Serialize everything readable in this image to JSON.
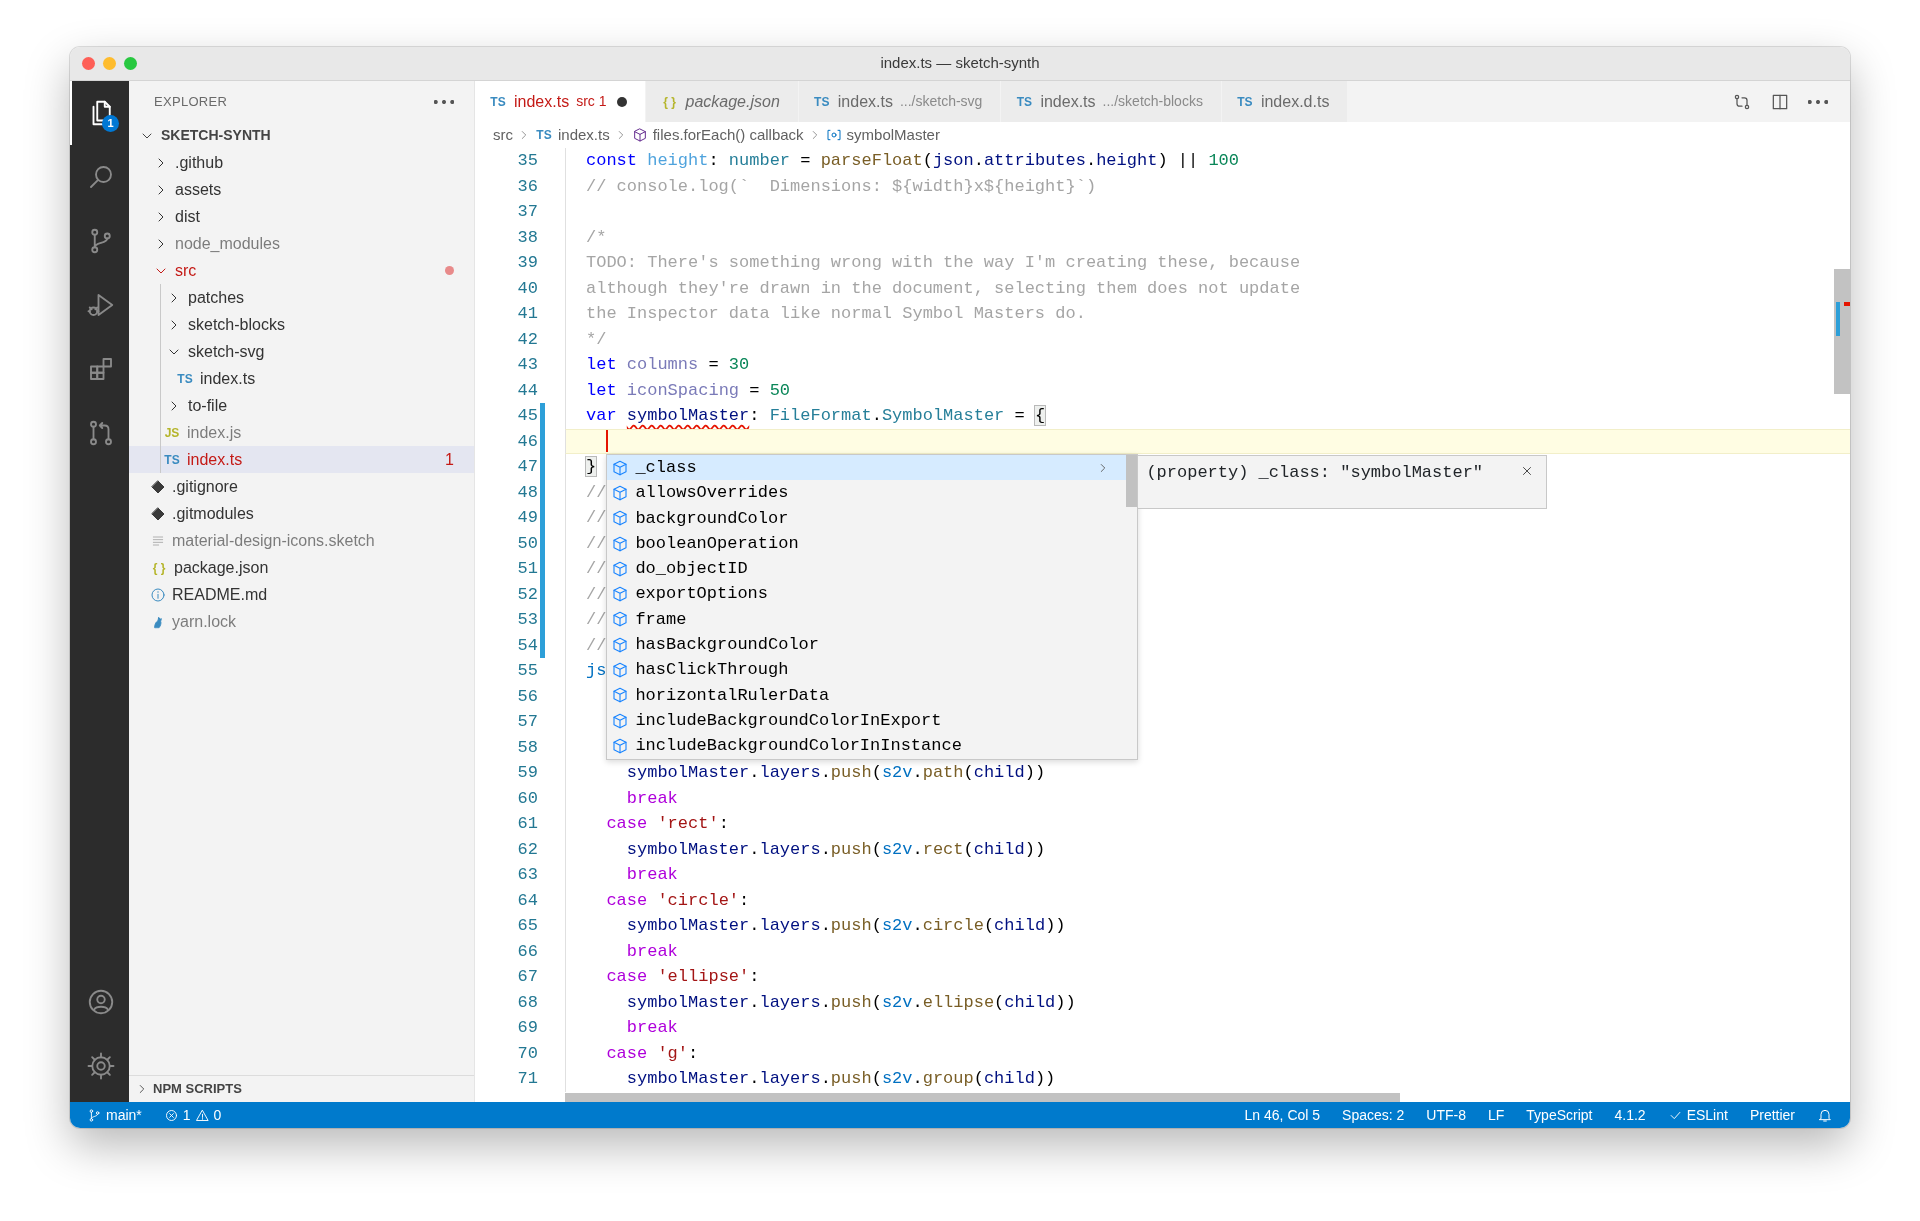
{
  "window": {
    "title": "index.ts — sketch-synth"
  },
  "activity_bar": {
    "top": [
      {
        "kind": "files",
        "selected": true,
        "badge": "1"
      },
      {
        "kind": "search",
        "selected": false
      },
      {
        "kind": "source-control",
        "selected": false
      },
      {
        "kind": "run-debug",
        "selected": false
      },
      {
        "kind": "extensions",
        "selected": false
      },
      {
        "kind": "pull-request",
        "selected": false
      }
    ],
    "bottom": [
      {
        "kind": "account",
        "selected": false
      },
      {
        "kind": "settings",
        "selected": false
      }
    ]
  },
  "explorer": {
    "title": "EXPLORER",
    "root": {
      "label": "SKETCH-SYNTH",
      "expanded": true,
      "children": [
        {
          "kind": "folder",
          "label": ".github",
          "expanded": false,
          "selected": false,
          "error": false,
          "ignored": false
        },
        {
          "kind": "folder",
          "label": "assets",
          "expanded": false,
          "selected": false,
          "error": false,
          "ignored": false
        },
        {
          "kind": "folder",
          "label": "dist",
          "expanded": false,
          "selected": false,
          "error": false,
          "ignored": false
        },
        {
          "kind": "folder",
          "label": "node_modules",
          "expanded": false,
          "selected": false,
          "error": false,
          "ignored": true
        },
        {
          "kind": "folder",
          "label": "src",
          "expanded": true,
          "selected": false,
          "error": true,
          "ignored": false,
          "problem_dot": true,
          "children": [
            {
              "kind": "folder",
              "label": "patches",
              "expanded": false,
              "selected": false,
              "error": false,
              "ignored": false
            },
            {
              "kind": "folder",
              "label": "sketch-blocks",
              "expanded": false,
              "selected": false,
              "error": false,
              "ignored": false
            },
            {
              "kind": "folder",
              "label": "sketch-svg",
              "expanded": true,
              "selected": false,
              "error": false,
              "ignored": false,
              "children": [
                {
                  "kind": "ts",
                  "icon_label": "TS",
                  "label": "index.ts",
                  "selected": false,
                  "error": false,
                  "ignored": false
                }
              ]
            },
            {
              "kind": "folder",
              "label": "to-file",
              "expanded": false,
              "selected": false,
              "error": false,
              "ignored": false
            },
            {
              "kind": "js",
              "icon_label": "JS",
              "label": "index.js",
              "selected": false,
              "error": false,
              "ignored": true
            },
            {
              "kind": "ts",
              "icon_label": "TS",
              "label": "index.ts",
              "selected": true,
              "error": true,
              "ignored": false,
              "problems": "1"
            }
          ]
        },
        {
          "kind": "git",
          "label": ".gitignore",
          "selected": false,
          "error": false,
          "ignored": false
        },
        {
          "kind": "git",
          "label": ".gitmodules",
          "selected": false,
          "error": false,
          "ignored": false
        },
        {
          "kind": "lines",
          "label": "material-design-icons.sketch",
          "selected": false,
          "error": false,
          "ignored": true
        },
        {
          "kind": "json",
          "icon_label": "{ }",
          "label": "package.json",
          "selected": false,
          "error": false,
          "ignored": false
        },
        {
          "kind": "info",
          "label": "README.md",
          "selected": false,
          "error": false,
          "ignored": false
        },
        {
          "kind": "yarn",
          "label": "yarn.lock",
          "selected": false,
          "error": false,
          "ignored": true
        }
      ]
    },
    "sections": [
      {
        "label": "NPM SCRIPTS",
        "expanded": false
      }
    ]
  },
  "tabs": [
    {
      "kind": "ts",
      "icon_label": "TS",
      "label": "index.ts",
      "description": "src",
      "problems": "1",
      "error": true,
      "dirty": true,
      "preview": false,
      "selected": true
    },
    {
      "kind": "json",
      "icon_label": "{ }",
      "label": "package.json",
      "error": false,
      "dirty": false,
      "preview": true,
      "selected": false
    },
    {
      "kind": "ts",
      "icon_label": "TS",
      "label": "index.ts",
      "description": ".../sketch-svg",
      "error": false,
      "dirty": false,
      "preview": false,
      "selected": false
    },
    {
      "kind": "ts",
      "icon_label": "TS",
      "label": "index.ts",
      "description": ".../sketch-blocks",
      "error": false,
      "dirty": false,
      "preview": false,
      "selected": false
    },
    {
      "kind": "ts",
      "icon_label": "TS",
      "label": "index.d.ts",
      "error": false,
      "dirty": false,
      "preview": false,
      "selected": false
    }
  ],
  "editor_actions": [
    {
      "kind": "compare"
    },
    {
      "kind": "split"
    },
    {
      "kind": "more"
    }
  ],
  "breadcrumbs": [
    {
      "label": "src"
    },
    {
      "kind": "ts",
      "icon_label": "TS",
      "label": "index.ts"
    },
    {
      "kind": "method",
      "label": "files.forEach() callback"
    },
    {
      "kind": "variable",
      "label": "symbolMaster"
    }
  ],
  "editor": {
    "lines": [
      {
        "number": "35",
        "modified": false,
        "current": false,
        "tokens": [
          {
            "kind": "keyword",
            "text": "const "
          },
          {
            "kind": "decl",
            "text": "height"
          },
          {
            "kind": "plain",
            "text": ": "
          },
          {
            "kind": "type",
            "text": "number"
          },
          {
            "kind": "plain",
            "text": " = "
          },
          {
            "kind": "function",
            "text": "parseFloat"
          },
          {
            "kind": "plain",
            "text": "("
          },
          {
            "kind": "variable",
            "text": "json"
          },
          {
            "kind": "plain",
            "text": "."
          },
          {
            "kind": "variable",
            "text": "attributes"
          },
          {
            "kind": "plain",
            "text": "."
          },
          {
            "kind": "variable",
            "text": "height"
          },
          {
            "kind": "plain",
            "text": ") || "
          },
          {
            "kind": "number",
            "text": "100"
          }
        ]
      },
      {
        "number": "36",
        "modified": false,
        "current": false,
        "tokens": [
          {
            "kind": "comment",
            "text": "// console.log(`  Dimensions: ${width}x${height}`)"
          }
        ]
      },
      {
        "number": "37",
        "modified": false,
        "current": false
      },
      {
        "number": "38",
        "modified": false,
        "current": false,
        "tokens": [
          {
            "kind": "comment",
            "text": "/*"
          }
        ]
      },
      {
        "number": "39",
        "modified": false,
        "current": false,
        "tokens": [
          {
            "kind": "comment",
            "text": "TODO: There's something wrong with the way I'm creating these, because"
          }
        ]
      },
      {
        "number": "40",
        "modified": false,
        "current": false,
        "tokens": [
          {
            "kind": "comment",
            "text": "although they're drawn in the document, selecting them does not update"
          }
        ]
      },
      {
        "number": "41",
        "modified": false,
        "current": false,
        "tokens": [
          {
            "kind": "comment",
            "text": "the Inspector data like normal Symbol Masters do."
          }
        ]
      },
      {
        "number": "42",
        "modified": false,
        "current": false,
        "tokens": [
          {
            "kind": "comment",
            "text": "*/"
          }
        ]
      },
      {
        "number": "43",
        "modified": false,
        "current": false,
        "tokens": [
          {
            "kind": "keyword",
            "text": "let "
          },
          {
            "kind": "local",
            "text": "columns"
          },
          {
            "kind": "plain",
            "text": " = "
          },
          {
            "kind": "number",
            "text": "30"
          }
        ]
      },
      {
        "number": "44",
        "modified": false,
        "current": false,
        "tokens": [
          {
            "kind": "keyword",
            "text": "let "
          },
          {
            "kind": "local",
            "text": "iconSpacing"
          },
          {
            "kind": "plain",
            "text": " = "
          },
          {
            "kind": "number",
            "text": "50"
          }
        ]
      },
      {
        "number": "45",
        "modified": true,
        "current": false,
        "tokens": [
          {
            "kind": "keyword",
            "text": "var "
          },
          {
            "kind": "variable",
            "text": "symbolMaster",
            "error": true
          },
          {
            "kind": "plain",
            "text": ": "
          },
          {
            "kind": "type",
            "text": "FileFormat"
          },
          {
            "kind": "plain",
            "text": "."
          },
          {
            "kind": "type",
            "text": "SymbolMaster"
          },
          {
            "kind": "plain",
            "text": " = "
          },
          {
            "kind": "plain",
            "text": "{",
            "matched": true
          }
        ]
      },
      {
        "number": "46",
        "modified": true,
        "current": true
      },
      {
        "number": "47",
        "modified": true,
        "current": false,
        "tokens": [
          {
            "kind": "plain",
            "text": "}",
            "matched": true
          }
        ]
      },
      {
        "number": "48",
        "modified": true,
        "current": false,
        "tokens": [
          {
            "kind": "comment",
            "text": "//"
          }
        ]
      },
      {
        "number": "49",
        "modified": true,
        "current": false,
        "tokens": [
          {
            "kind": "comment",
            "text": "//"
          }
        ]
      },
      {
        "number": "50",
        "modified": true,
        "current": false,
        "tokens": [
          {
            "kind": "comment",
            "text": "//"
          }
        ]
      },
      {
        "number": "51",
        "modified": true,
        "current": false,
        "tokens": [
          {
            "kind": "comment",
            "text": "//"
          }
        ]
      },
      {
        "number": "52",
        "modified": true,
        "current": false,
        "tokens": [
          {
            "kind": "comment",
            "text": "//"
          }
        ]
      },
      {
        "number": "53",
        "modified": true,
        "current": false,
        "tokens": [
          {
            "kind": "comment",
            "text": "//"
          }
        ]
      },
      {
        "number": "54",
        "modified": true,
        "current": false,
        "tokens": [
          {
            "kind": "comment",
            "text": "//"
          }
        ]
      },
      {
        "number": "55",
        "modified": false,
        "current": false,
        "tokens": [
          {
            "kind": "ns",
            "text": "js"
          }
        ]
      },
      {
        "number": "56",
        "modified": false,
        "current": false
      },
      {
        "number": "57",
        "modified": false,
        "current": false
      },
      {
        "number": "58",
        "modified": false,
        "current": false
      },
      {
        "number": "59",
        "modified": false,
        "current": false,
        "tokens": [
          {
            "kind": "variable",
            "text": "    symbolMaster"
          },
          {
            "kind": "plain",
            "text": "."
          },
          {
            "kind": "variable",
            "text": "layers"
          },
          {
            "kind": "plain",
            "text": "."
          },
          {
            "kind": "function",
            "text": "push"
          },
          {
            "kind": "plain",
            "text": "("
          },
          {
            "kind": "ns",
            "text": "s2v"
          },
          {
            "kind": "plain",
            "text": "."
          },
          {
            "kind": "function",
            "text": "path"
          },
          {
            "kind": "plain",
            "text": "("
          },
          {
            "kind": "variable",
            "text": "child"
          },
          {
            "kind": "plain",
            "text": "))"
          }
        ]
      },
      {
        "number": "60",
        "modified": false,
        "current": false,
        "tokens": [
          {
            "kind": "control",
            "text": "    break"
          }
        ]
      },
      {
        "number": "61",
        "modified": false,
        "current": false,
        "tokens": [
          {
            "kind": "control",
            "text": "  case "
          },
          {
            "kind": "string",
            "text": "'rect'"
          },
          {
            "kind": "plain",
            "text": ":"
          }
        ]
      },
      {
        "number": "62",
        "modified": false,
        "current": false,
        "tokens": [
          {
            "kind": "variable",
            "text": "    symbolMaster"
          },
          {
            "kind": "plain",
            "text": "."
          },
          {
            "kind": "variable",
            "text": "layers"
          },
          {
            "kind": "plain",
            "text": "."
          },
          {
            "kind": "function",
            "text": "push"
          },
          {
            "kind": "plain",
            "text": "("
          },
          {
            "kind": "ns",
            "text": "s2v"
          },
          {
            "kind": "plain",
            "text": "."
          },
          {
            "kind": "function",
            "text": "rect"
          },
          {
            "kind": "plain",
            "text": "("
          },
          {
            "kind": "variable",
            "text": "child"
          },
          {
            "kind": "plain",
            "text": "))"
          }
        ]
      },
      {
        "number": "63",
        "modified": false,
        "current": false,
        "tokens": [
          {
            "kind": "control",
            "text": "    break"
          }
        ]
      },
      {
        "number": "64",
        "modified": false,
        "current": false,
        "tokens": [
          {
            "kind": "control",
            "text": "  case "
          },
          {
            "kind": "string",
            "text": "'circle'"
          },
          {
            "kind": "plain",
            "text": ":"
          }
        ]
      },
      {
        "number": "65",
        "modified": false,
        "current": false,
        "tokens": [
          {
            "kind": "variable",
            "text": "    symbolMaster"
          },
          {
            "kind": "plain",
            "text": "."
          },
          {
            "kind": "variable",
            "text": "layers"
          },
          {
            "kind": "plain",
            "text": "."
          },
          {
            "kind": "function",
            "text": "push"
          },
          {
            "kind": "plain",
            "text": "("
          },
          {
            "kind": "ns",
            "text": "s2v"
          },
          {
            "kind": "plain",
            "text": "."
          },
          {
            "kind": "function",
            "text": "circle"
          },
          {
            "kind": "plain",
            "text": "("
          },
          {
            "kind": "variable",
            "text": "child"
          },
          {
            "kind": "plain",
            "text": "))"
          }
        ]
      },
      {
        "number": "66",
        "modified": false,
        "current": false,
        "tokens": [
          {
            "kind": "control",
            "text": "    break"
          }
        ]
      },
      {
        "number": "67",
        "modified": false,
        "current": false,
        "tokens": [
          {
            "kind": "control",
            "text": "  case "
          },
          {
            "kind": "string",
            "text": "'ellipse'"
          },
          {
            "kind": "plain",
            "text": ":"
          }
        ]
      },
      {
        "number": "68",
        "modified": false,
        "current": false,
        "tokens": [
          {
            "kind": "variable",
            "text": "    symbolMaster"
          },
          {
            "kind": "plain",
            "text": "."
          },
          {
            "kind": "variable",
            "text": "layers"
          },
          {
            "kind": "plain",
            "text": "."
          },
          {
            "kind": "function",
            "text": "push"
          },
          {
            "kind": "plain",
            "text": "("
          },
          {
            "kind": "ns",
            "text": "s2v"
          },
          {
            "kind": "plain",
            "text": "."
          },
          {
            "kind": "function",
            "text": "ellipse"
          },
          {
            "kind": "plain",
            "text": "("
          },
          {
            "kind": "variable",
            "text": "child"
          },
          {
            "kind": "plain",
            "text": "))"
          }
        ]
      },
      {
        "number": "69",
        "modified": false,
        "current": false,
        "tokens": [
          {
            "kind": "control",
            "text": "    break"
          }
        ]
      },
      {
        "number": "70",
        "modified": false,
        "current": false,
        "tokens": [
          {
            "kind": "control",
            "text": "  case "
          },
          {
            "kind": "string",
            "text": "'g'"
          },
          {
            "kind": "plain",
            "text": ":"
          }
        ]
      },
      {
        "number": "71",
        "modified": false,
        "current": false,
        "tokens": [
          {
            "kind": "variable",
            "text": "    symbolMaster"
          },
          {
            "kind": "plain",
            "text": "."
          },
          {
            "kind": "variable",
            "text": "layers"
          },
          {
            "kind": "plain",
            "text": "."
          },
          {
            "kind": "function",
            "text": "push"
          },
          {
            "kind": "plain",
            "text": "("
          },
          {
            "kind": "ns",
            "text": "s2v"
          },
          {
            "kind": "plain",
            "text": "."
          },
          {
            "kind": "function",
            "text": "group"
          },
          {
            "kind": "plain",
            "text": "("
          },
          {
            "kind": "variable",
            "text": "child"
          },
          {
            "kind": "plain",
            "text": "))"
          }
        ]
      }
    ],
    "suggestions": {
      "items": [
        {
          "label": "_class",
          "selected": true
        },
        {
          "label": "allowsOverrides",
          "selected": false
        },
        {
          "label": "backgroundColor",
          "selected": false
        },
        {
          "label": "booleanOperation",
          "selected": false
        },
        {
          "label": "do_objectID",
          "selected": false
        },
        {
          "label": "exportOptions",
          "selected": false
        },
        {
          "label": "frame",
          "selected": false
        },
        {
          "label": "hasBackgroundColor",
          "selected": false
        },
        {
          "label": "hasClickThrough",
          "selected": false
        },
        {
          "label": "horizontalRulerData",
          "selected": false
        },
        {
          "label": "includeBackgroundColorInExport",
          "selected": false
        },
        {
          "label": "includeBackgroundColorInInstance",
          "selected": false
        }
      ],
      "detail": "(property) _class: \"symbolMaster\""
    }
  },
  "status_bar": {
    "left": [
      {
        "kind": "branch",
        "label": "main*"
      },
      {
        "kind": "problems",
        "errors": "1",
        "warnings": "0"
      }
    ],
    "right": [
      {
        "kind": "text",
        "label": "Ln 46, Col 5"
      },
      {
        "kind": "text",
        "label": "Spaces: 2"
      },
      {
        "kind": "text",
        "label": "UTF-8"
      },
      {
        "kind": "text",
        "label": "LF"
      },
      {
        "kind": "text",
        "label": "TypeScript"
      },
      {
        "kind": "text",
        "label": "4.1.2"
      },
      {
        "kind": "check",
        "label": "ESLint"
      },
      {
        "kind": "text",
        "label": "Prettier"
      },
      {
        "kind": "bell"
      }
    ]
  }
}
